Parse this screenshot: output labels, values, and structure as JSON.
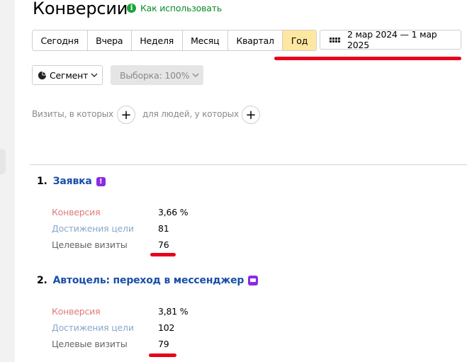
{
  "header": {
    "title": "Конверсии",
    "howto_label": "Как использовать"
  },
  "periods": [
    {
      "label": "Сегодня",
      "active": false
    },
    {
      "label": "Вчера",
      "active": false
    },
    {
      "label": "Неделя",
      "active": false
    },
    {
      "label": "Месяц",
      "active": false
    },
    {
      "label": "Квартал",
      "active": false
    },
    {
      "label": "Год",
      "active": true
    }
  ],
  "date_range": {
    "label": "2 мар 2024 — 1 мар 2025",
    "icon": "calendar-icon"
  },
  "segment": {
    "label": "Сегмент",
    "icon": "pie-chart-icon"
  },
  "sample": {
    "label": "Выборка: 100%"
  },
  "filters": {
    "visits_label": "Визиты, в которых",
    "people_label": "для людей, у которых"
  },
  "goals": [
    {
      "number": "1.",
      "name": "Заявка",
      "icon": "exclamation-badge-icon",
      "metrics": {
        "conversion_label": "Конверсия",
        "conversion_value": "3,66 %",
        "reaches_label": "Достижения цели",
        "reaches_value": "81",
        "visits_label": "Целевые визиты",
        "visits_value": "76"
      }
    },
    {
      "number": "2.",
      "name": "Автоцель: переход в мессенджер",
      "icon": "chat-badge-icon",
      "metrics": {
        "conversion_label": "Конверсия",
        "conversion_value": "3,81 %",
        "reaches_label": "Достижения цели",
        "reaches_value": "102",
        "visits_label": "Целевые визиты",
        "visits_value": "79"
      }
    }
  ],
  "colors": {
    "active_period_bg": "#fde7a1",
    "link": "#1a4fa8",
    "howto": "#0a8a2a",
    "highlight_red": "#e8001c",
    "badge": "#8a2be2"
  }
}
